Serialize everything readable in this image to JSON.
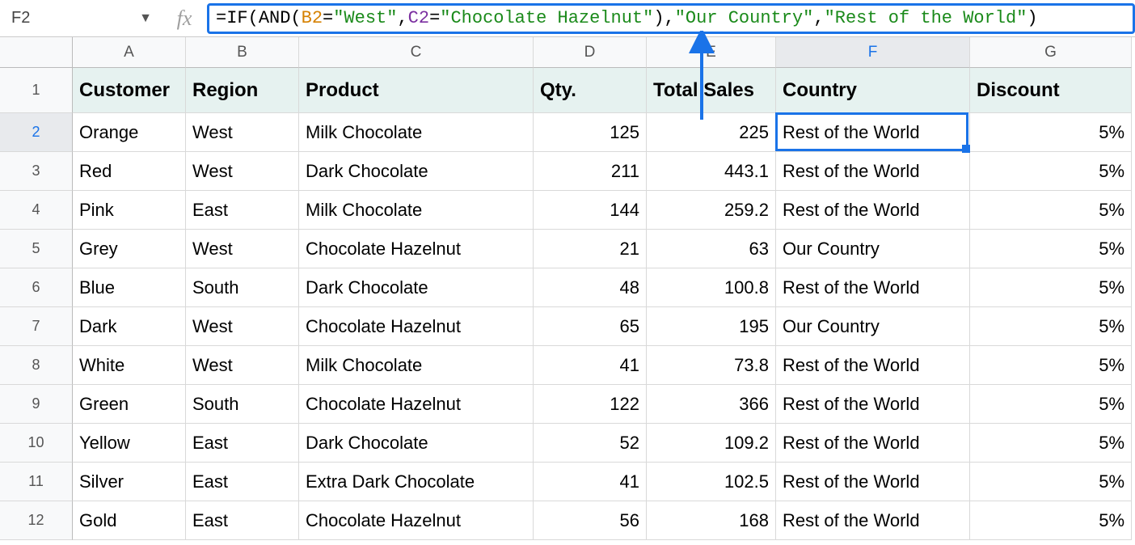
{
  "namebox": "F2",
  "formula": {
    "fn1": "IF",
    "fn2": "AND",
    "ref1": "B2",
    "ref2": "C2",
    "str1": "\"West\"",
    "str2": "\"Chocolate Hazelnut\"",
    "str3": "\"Our Country\"",
    "str4": "\"Rest of the World\""
  },
  "columns": [
    "A",
    "B",
    "C",
    "D",
    "E",
    "F",
    "G"
  ],
  "headers": {
    "A": "Customer",
    "B": "Region",
    "C": "Product",
    "D": "Qty.",
    "E": "Total Sales",
    "F": "Country",
    "G": "Discount"
  },
  "rows": [
    {
      "n": "2",
      "A": "Orange",
      "B": "West",
      "C": "Milk Chocolate",
      "D": "125",
      "E": "225",
      "F": "Rest of the World",
      "G": "5%"
    },
    {
      "n": "3",
      "A": "Red",
      "B": "West",
      "C": "Dark Chocolate",
      "D": "211",
      "E": "443.1",
      "F": "Rest of the World",
      "G": "5%"
    },
    {
      "n": "4",
      "A": "Pink",
      "B": "East",
      "C": "Milk Chocolate",
      "D": "144",
      "E": "259.2",
      "F": "Rest of the World",
      "G": "5%"
    },
    {
      "n": "5",
      "A": "Grey",
      "B": "West",
      "C": "Chocolate Hazelnut",
      "D": "21",
      "E": "63",
      "F": "Our Country",
      "G": "5%"
    },
    {
      "n": "6",
      "A": "Blue",
      "B": "South",
      "C": "Dark Chocolate",
      "D": "48",
      "E": "100.8",
      "F": "Rest of the World",
      "G": "5%"
    },
    {
      "n": "7",
      "A": "Dark",
      "B": "West",
      "C": "Chocolate Hazelnut",
      "D": "65",
      "E": "195",
      "F": "Our Country",
      "G": "5%"
    },
    {
      "n": "8",
      "A": "White",
      "B": "West",
      "C": "Milk Chocolate",
      "D": "41",
      "E": "73.8",
      "F": "Rest of the World",
      "G": "5%"
    },
    {
      "n": "9",
      "A": "Green",
      "B": "South",
      "C": "Chocolate Hazelnut",
      "D": "122",
      "E": "366",
      "F": "Rest of the World",
      "G": "5%"
    },
    {
      "n": "10",
      "A": "Yellow",
      "B": "East",
      "C": "Dark Chocolate",
      "D": "52",
      "E": "109.2",
      "F": "Rest of the World",
      "G": "5%"
    },
    {
      "n": "11",
      "A": "Silver",
      "B": "East",
      "C": "Extra Dark Chocolate",
      "D": "41",
      "E": "102.5",
      "F": "Rest of the World",
      "G": "5%"
    },
    {
      "n": "12",
      "A": "Gold",
      "B": "East",
      "C": "Chocolate Hazelnut",
      "D": "56",
      "E": "168",
      "F": "Rest of the World",
      "G": "5%"
    }
  ],
  "selected": {
    "col": "F",
    "row": "2"
  }
}
